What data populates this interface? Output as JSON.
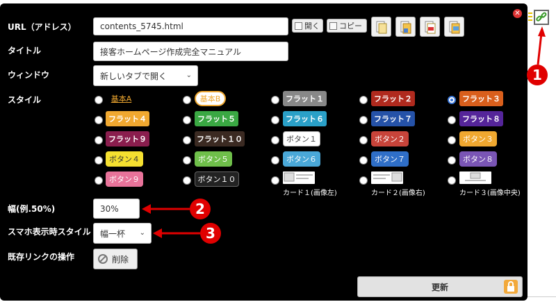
{
  "form": {
    "url_label": "URL（アドレス）",
    "url_value": "contents_5745.html",
    "open_label": "開く",
    "copy_label": "コピー",
    "title_label": "タイトル",
    "title_value": "接客ホームページ作成完全マニュアル",
    "window_label": "ウィンドウ",
    "window_value": "新しいタブで開く",
    "style_label": "スタイル",
    "width_label": "幅(例.50%)",
    "width_value": "30%",
    "mobile_label": "スマホ表示時スタイル",
    "mobile_value": "幅一杯",
    "existing_label": "既存リンクの操作",
    "delete_label": "削除",
    "update_label": "更新"
  },
  "styles": {
    "row1": [
      {
        "label": "基本A",
        "color": "#f0a830"
      },
      {
        "label": "基本B",
        "color": "#f0a830"
      },
      {
        "label": "フラット１",
        "color": "#888888"
      },
      {
        "label": "フラット２",
        "color": "#b02a1e"
      },
      {
        "label": "フラット３",
        "color": "#d95f1c"
      }
    ],
    "row2": [
      {
        "label": "フラット４",
        "color": "#f0a830"
      },
      {
        "label": "フラット５",
        "color": "#3aa843"
      },
      {
        "label": "フラット６",
        "color": "#2aa0c8"
      },
      {
        "label": "フラット７",
        "color": "#2552a8"
      },
      {
        "label": "フラット８",
        "color": "#55259a"
      }
    ],
    "row3": [
      {
        "label": "フラット９",
        "color": "#8a1e4e"
      },
      {
        "label": "フラット１０",
        "color": "#3b2a22"
      },
      {
        "label": "ボタン１",
        "color": "#ffffff"
      },
      {
        "label": "ボタン２",
        "color": "#c8443a"
      },
      {
        "label": "ボタン３",
        "color": "#f0a830"
      }
    ],
    "row4": [
      {
        "label": "ボタン４",
        "color": "#f5e030"
      },
      {
        "label": "ボタン５",
        "color": "#6fbf4a"
      },
      {
        "label": "ボタン６",
        "color": "#4aa8d8"
      },
      {
        "label": "ボタン７",
        "color": "#2f6fc8"
      },
      {
        "label": "ボタン８",
        "color": "#7a55b5"
      }
    ],
    "row5": [
      {
        "label": "ボタン９",
        "color": "#e8739a"
      },
      {
        "label": "ボタン１０",
        "color": "#222222"
      },
      {
        "label": "カード１(画像左)"
      },
      {
        "label": "カード２(画像右)"
      },
      {
        "label": "カード３(画像中央)"
      }
    ],
    "selected": "フラット３"
  },
  "annotations": {
    "badge1": "1",
    "badge2": "2",
    "badge3": "3",
    "color": "#e00000"
  }
}
